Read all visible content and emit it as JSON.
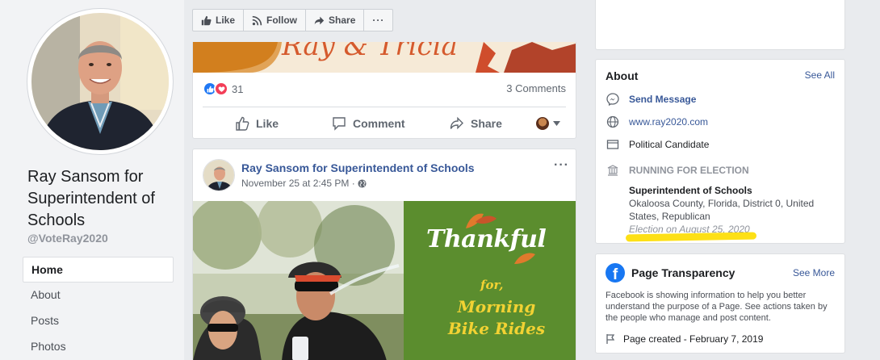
{
  "profile": {
    "name": "Ray Sansom for Superintendent of Schools",
    "handle": "@VoteRay2020"
  },
  "nav": {
    "items": [
      {
        "label": "Home",
        "active": true
      },
      {
        "label": "About",
        "active": false
      },
      {
        "label": "Posts",
        "active": false
      },
      {
        "label": "Photos",
        "active": false
      }
    ]
  },
  "action_bar": {
    "like_label": "Like",
    "follow_label": "Follow",
    "share_label": "Share",
    "more_label": "···"
  },
  "post1": {
    "reaction_count": "31",
    "comments": "3 Comments",
    "like_label": "Like",
    "comment_label": "Comment",
    "share_label": "Share"
  },
  "post2": {
    "author": "Ray Sansom for Superintendent of Schools",
    "timestamp": "November 25 at 2:45 PM · ",
    "more": "···",
    "image_text": {
      "title": "Thankful",
      "for": "for,",
      "subtitle": "Morning Bike Rides"
    }
  },
  "about": {
    "title": "About",
    "see_all": "See All",
    "send_message": "Send Message",
    "website": "www.ray2020.com",
    "category": "Political Candidate",
    "running_label": "RUNNING FOR ELECTION",
    "election_title": "Superintendent of Schools",
    "election_location": "Okaloosa County, Florida, District 0, United States, Republican",
    "election_date": "Election on August 25, 2020"
  },
  "transparency": {
    "title": "Page Transparency",
    "see_more": "See More",
    "description": "Facebook is showing information to help you better understand the purpose of a Page. See actions taken by the people who manage and post content.",
    "page_created": "Page created - February 7, 2019"
  },
  "colors": {
    "link": "#385898",
    "facebook_blue": "#1877f2",
    "highlight": "#fde016",
    "thankful_green": "#5b8d2e"
  }
}
